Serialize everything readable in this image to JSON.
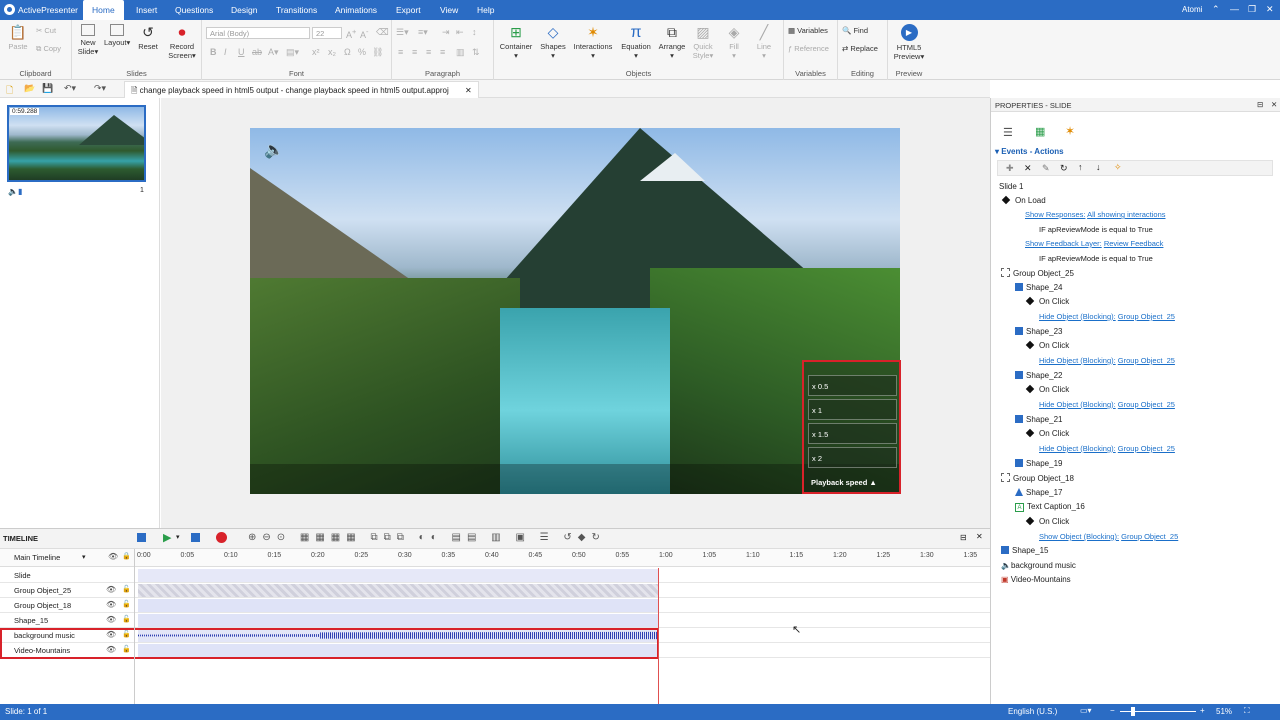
{
  "app": {
    "name": "ActivePresenter",
    "user": "Atomi"
  },
  "menu_tabs": [
    "Home",
    "Insert",
    "Questions",
    "Design",
    "Transitions",
    "Animations",
    "Export",
    "View",
    "Help"
  ],
  "ribbon": {
    "clipboard": {
      "label": "Clipboard",
      "paste": "Paste",
      "cut": "Cut",
      "copy": "Copy"
    },
    "slides": {
      "label": "Slides",
      "new_slide": "New\nSlide",
      "layout": "Layout",
      "reset": "Reset",
      "record_screen": "Record\nScreen"
    },
    "font": {
      "label": "Font",
      "font_name": "Arial (Body)",
      "font_size": "22"
    },
    "paragraph": {
      "label": "Paragraph"
    },
    "objects": {
      "label": "Objects",
      "container": "Container",
      "shapes": "Shapes",
      "interactions": "Interactions",
      "equation": "Equation",
      "arrange": "Arrange",
      "quick_style": "Quick\nStyle",
      "fill": "Fill",
      "line": "Line"
    },
    "variables": {
      "label": "Variables",
      "variables": "Variables",
      "reference": "Reference"
    },
    "editing": {
      "label": "Editing",
      "find": "Find",
      "replace": "Replace"
    },
    "preview": {
      "label": "Preview",
      "html5_preview": "HTML5\nPreview"
    }
  },
  "document_tab": "change playback speed in html5 output - change playback speed in html5 output.approj",
  "slide_panel": {
    "duration": "0:59.288",
    "slide_number": "1"
  },
  "speed_options": [
    "x 0.5",
    "x 1",
    "x 1.5",
    "x 2"
  ],
  "playback_speed_label": "Playback speed",
  "timeline": {
    "title": "TIMELINE",
    "main_timeline": "Main Timeline",
    "ticks": [
      "0:00",
      "0:05",
      "0:10",
      "0:15",
      "0:20",
      "0:25",
      "0:30",
      "0:35",
      "0:40",
      "0:45",
      "0:50",
      "0:55",
      "1:00",
      "1:05",
      "1:10",
      "1:15",
      "1:20",
      "1:25",
      "1:30",
      "1:35"
    ],
    "rows": [
      "Slide",
      "Group Object_25",
      "Group Object_18",
      "Shape_15",
      "background music",
      "Video-Mountains"
    ]
  },
  "properties": {
    "title": "PROPERTIES - SLIDE",
    "events_actions": "Events - Actions",
    "slide": "Slide 1",
    "on_load": "On Load",
    "show_responses": "Show Responses:",
    "all_showing": "All showing interactions",
    "if_review": "IF apReviewMode is equal to True",
    "show_feedback": "Show Feedback Layer:",
    "review_feedback": "Review Feedback",
    "group25": "Group Object_25",
    "shape24": "Shape_24",
    "shape23": "Shape_23",
    "shape22": "Shape_22",
    "shape21": "Shape_21",
    "shape19": "Shape_19",
    "group18": "Group Object_18",
    "shape17": "Shape_17",
    "text_caption": "Text Caption_16",
    "on_click": "On Click",
    "hide_object": "Hide Object (Blocking):",
    "show_object": "Show Object (Blocking):",
    "shape15": "Shape_15",
    "bg_music": "background music",
    "video": "Video-Mountains"
  },
  "status": {
    "slide": "Slide: 1 of 1",
    "language": "English (U.S.)",
    "zoom": "51%"
  },
  "colors": {
    "accent": "#2b6cc4",
    "highlight": "#d8222a",
    "link": "#1a6fc9"
  }
}
